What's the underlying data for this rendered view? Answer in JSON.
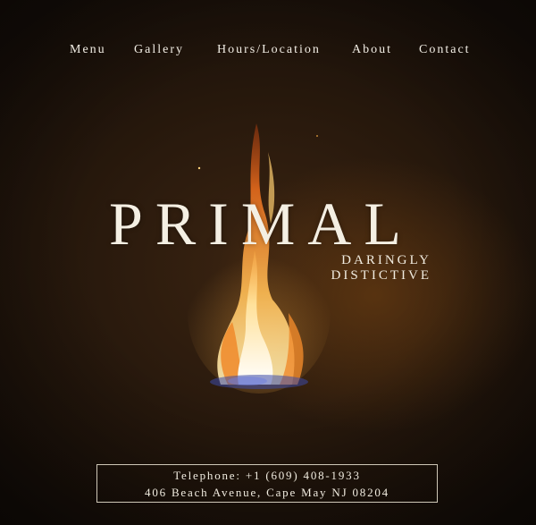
{
  "nav": {
    "items": [
      {
        "label": "Menu"
      },
      {
        "label": "Gallery"
      },
      {
        "label": "Hours/Location"
      },
      {
        "label": "About"
      },
      {
        "label": "Contact"
      }
    ]
  },
  "hero": {
    "brand": "PRIMAL",
    "tagline_line1": "DARINGLY",
    "tagline_line2": "DISTICTIVE"
  },
  "contact": {
    "phone": "Telephone: +1 (609) 408-1933",
    "address": "406 Beach Avenue, Cape May NJ 08204"
  },
  "colors": {
    "background": "#2a1a0d",
    "text": "#f1ece0",
    "flame_core": "#ffd27a",
    "flame_outer": "#d8541a",
    "flame_base": "#3c4aa8"
  },
  "icons": {
    "flame": "flame-icon"
  }
}
